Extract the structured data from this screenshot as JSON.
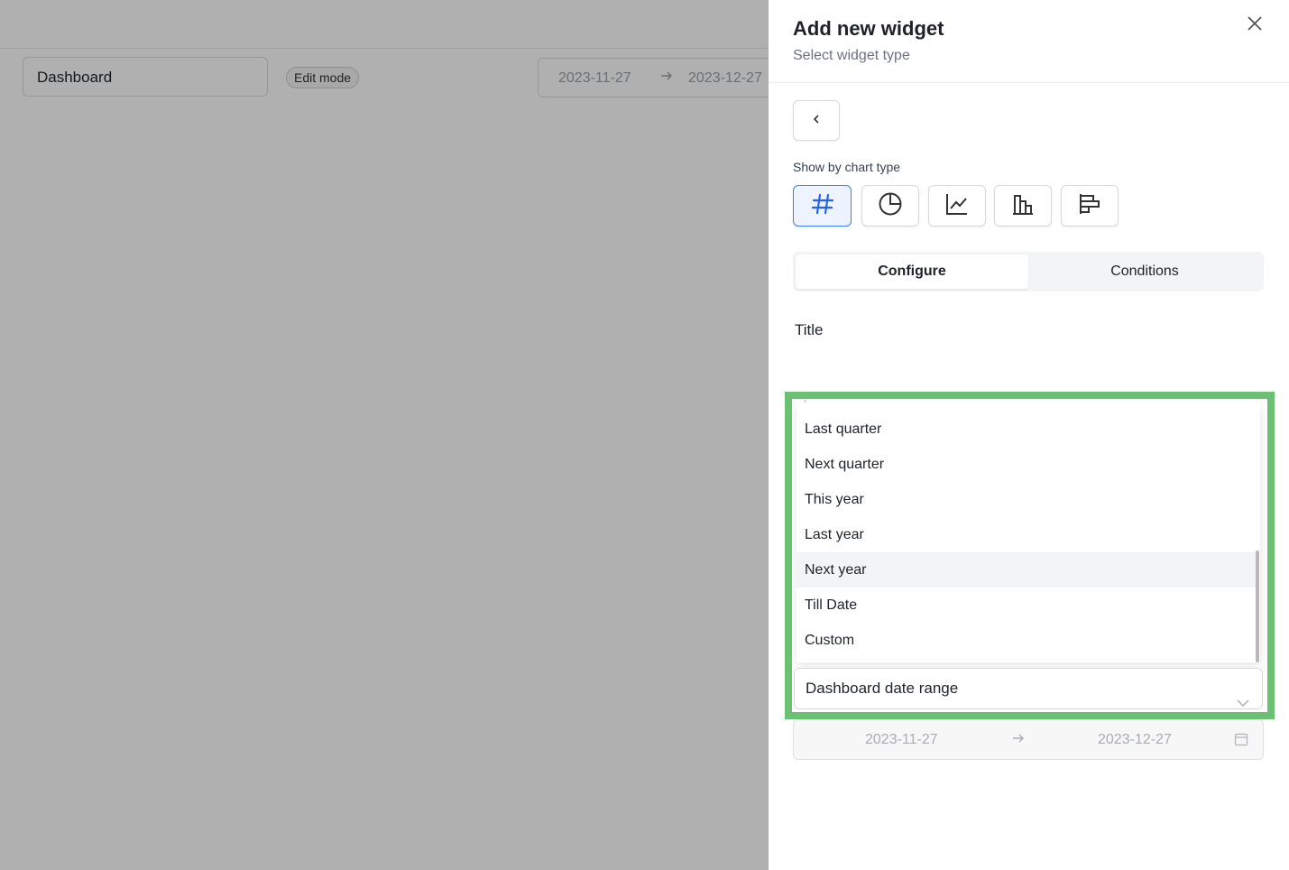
{
  "background": {
    "dashboard_name": "Dashboard",
    "edit_mode_label": "Edit mode",
    "date_start": "2023-11-27",
    "date_end": "2023-12-27"
  },
  "drawer": {
    "title": "Add new widget",
    "subtitle": "Select widget type",
    "chart_type_label": "Show by chart type",
    "chart_types": [
      "number-icon",
      "pie-chart-icon",
      "line-chart-icon",
      "bar-chart-icon",
      "horizontal-bar-chart-icon"
    ],
    "active_chart_type": "number-icon",
    "tabs": {
      "configure": "Configure",
      "conditions": "Conditions"
    },
    "title_field_label": "Title",
    "dropdown": {
      "options": [
        "Last quarter",
        "Next quarter",
        "This year",
        "Last year",
        "Next year",
        "Till Date",
        "Custom"
      ],
      "highlighted": "Next year",
      "selected_value": "Dashboard date range"
    },
    "date_range": {
      "start": "2023-11-27",
      "end": "2023-12-27"
    }
  },
  "colors": {
    "accent": "#3b82f6",
    "highlight_border": "#6cc074"
  }
}
